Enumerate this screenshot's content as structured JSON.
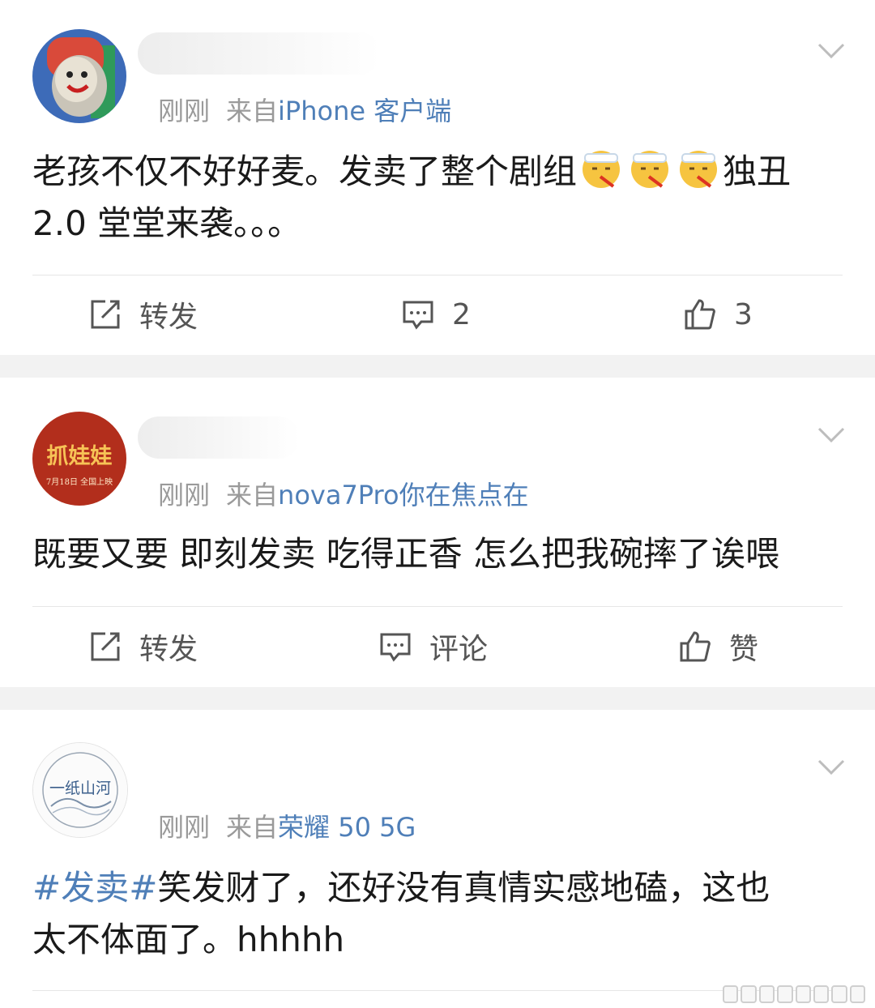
{
  "posts": [
    {
      "time": "刚刚",
      "source_prefix": "来自",
      "source": "iPhone 客户端",
      "text_part1": "老孩不仅不好好麦。发卖了整个剧组",
      "emoji_icon": "face-with-thermometer-icon",
      "text_part2": "独丑",
      "text_line2": "2.0 堂堂来袭。。。",
      "actions": {
        "repost": "转发",
        "comment": "2",
        "like": "3"
      }
    },
    {
      "avatar_text_main": "抓娃娃",
      "avatar_text_sub": "7月18日 全国上映",
      "time": "刚刚",
      "source_prefix": "来自",
      "source": "nova7Pro你在焦点在",
      "text": "既要又要 即刻发卖 吃得正香 怎么把我碗摔了诶喂",
      "actions": {
        "repost": "转发",
        "comment": "评论",
        "like": "赞"
      }
    },
    {
      "avatar_text_main": "一纸山河",
      "time": "刚刚",
      "source_prefix": "来自",
      "source": "荣耀 50 5G",
      "hashtag": "#发卖#",
      "text_line1": "笑发财了，还好没有真情实感地磕，这也",
      "text_line2": "太不体面了。hhhhh"
    }
  ],
  "colors": {
    "link_blue": "#4f7fb8",
    "meta_gray": "#9a9a9a",
    "page_bg": "#f2f2f2"
  }
}
